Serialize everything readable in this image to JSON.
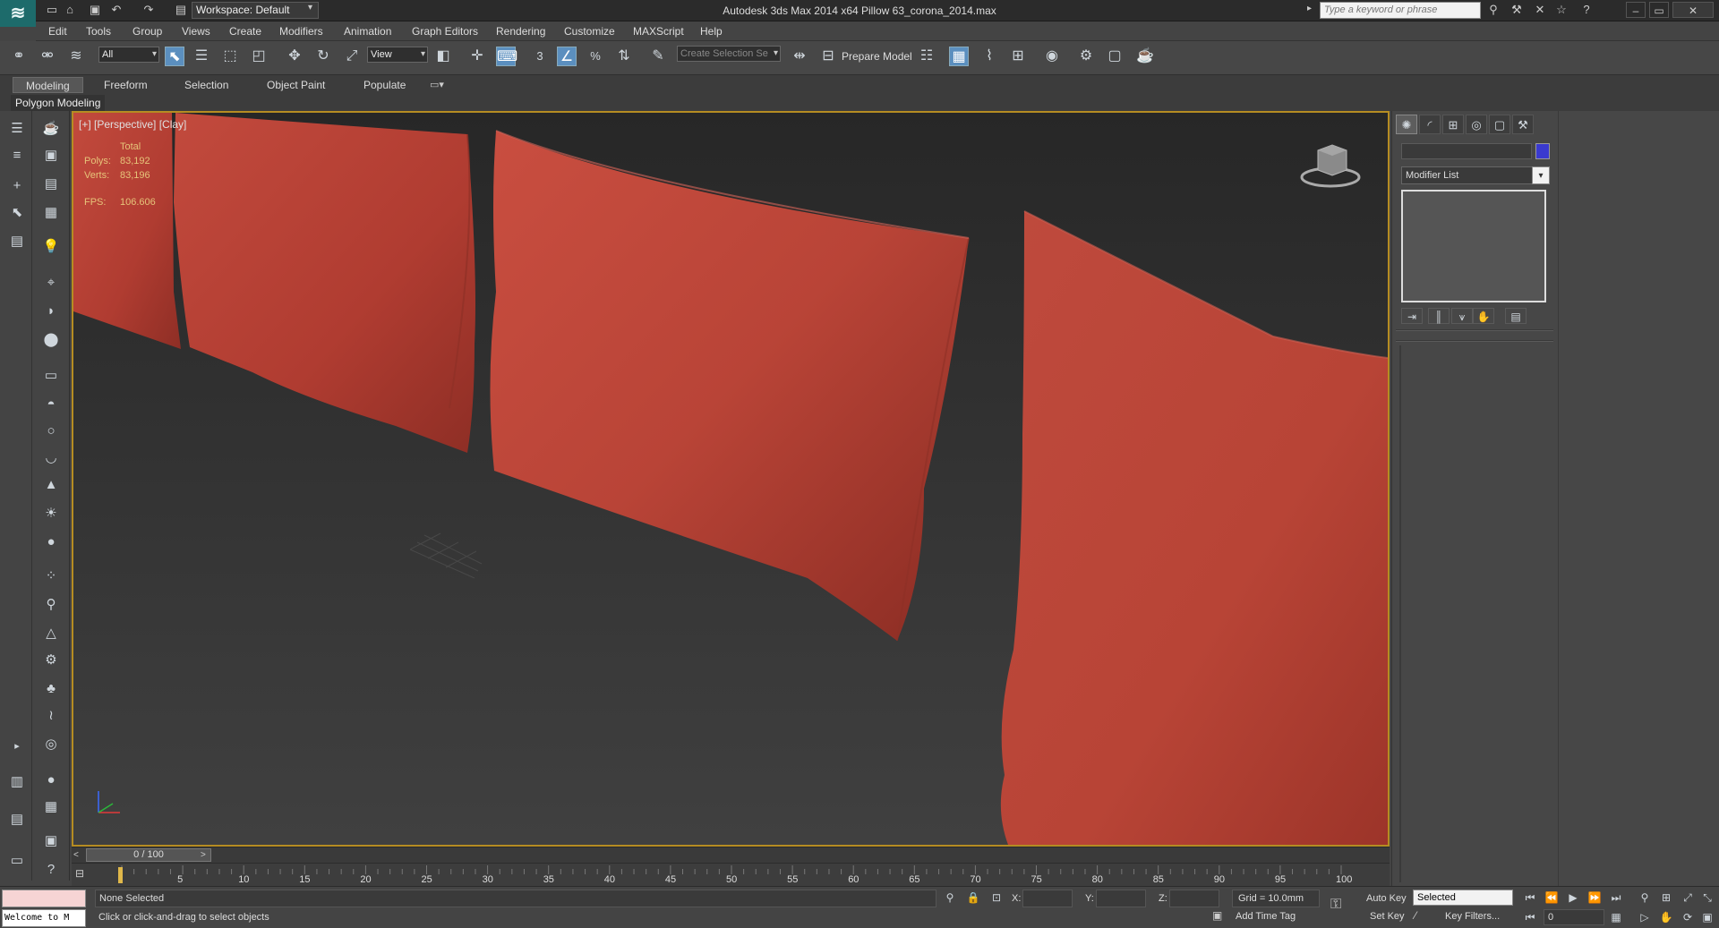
{
  "window": {
    "title": "Autodesk 3ds Max  2014 x64     Pillow 63_corona_2014.max",
    "workspace": "Workspace: Default",
    "search_placeholder": "Type a keyword or phrase",
    "icons": [
      "new-icon",
      "open-icon",
      "save-icon",
      "undo-icon",
      "redo-icon",
      "project-icon"
    ]
  },
  "menu": {
    "items": [
      "Edit",
      "Tools",
      "Group",
      "Views",
      "Create",
      "Modifiers",
      "Animation",
      "Graph Editors",
      "Rendering",
      "Customize",
      "MAXScript",
      "Help"
    ]
  },
  "toolbar": {
    "filter_value": "All",
    "refcoord_value": "View",
    "named_selection_placeholder": "Create Selection Se",
    "prepare_model": "Prepare Model",
    "snap_labels": [
      "3",
      "%"
    ]
  },
  "ribbon": {
    "tabs": [
      "Modeling",
      "Freeform",
      "Selection",
      "Object Paint",
      "Populate"
    ],
    "active_tab": "Modeling",
    "panel_label": "Polygon Modeling"
  },
  "viewport": {
    "label": "[+] [Perspective] [Clay]",
    "stats": {
      "header": "Total",
      "polys_label": "Polys:",
      "polys_value": "83,192",
      "verts_label": "Verts:",
      "verts_value": "83,196",
      "fps_label": "FPS:",
      "fps_value": "106.606"
    },
    "pillow_color": "#c0463a",
    "border_color": "#b58c22"
  },
  "timeline": {
    "position": "0 / 100",
    "ticks": [
      "5",
      "10",
      "15",
      "20",
      "25",
      "30",
      "35",
      "40",
      "45",
      "50",
      "55",
      "60",
      "65",
      "70",
      "75",
      "80",
      "85",
      "90",
      "95",
      "100"
    ]
  },
  "status": {
    "maxscript_text": "Welcome to M",
    "selection": "None Selected",
    "prompt": "Click or click-and-drag to select objects",
    "x_label": "X:",
    "y_label": "Y:",
    "z_label": "Z:",
    "grid": "Grid = 10.0mm",
    "add_time_tag": "Add Time Tag",
    "auto_key": "Auto Key",
    "set_key": "Set Key",
    "key_mode": "Selected",
    "key_filters": "Key Filters...",
    "frame": "0"
  },
  "command_panel": {
    "modifier_list": "Modifier List",
    "object_color": "#3a3acf",
    "tabs": [
      "create-icon",
      "modify-icon",
      "hierarchy-icon",
      "motion-icon",
      "display-icon",
      "utilities-icon"
    ]
  }
}
